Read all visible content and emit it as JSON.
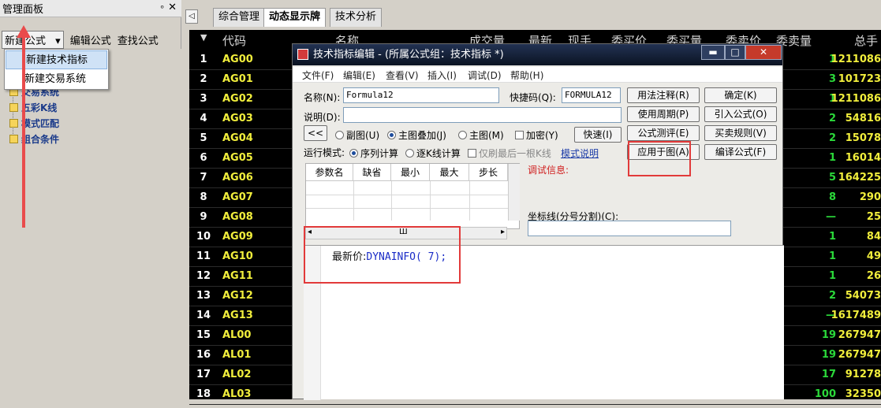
{
  "left_panel": {
    "title": "管理面板",
    "pin": "ᵒ",
    "close": "✕",
    "toolbar": {
      "new": "新建公式",
      "edit": "编辑公式",
      "find": "查找公式"
    },
    "dropdown": [
      "新建技术指标",
      "新建交易系统"
    ],
    "tree": [
      "交易系统",
      "五彩K线",
      "模式匹配",
      "组合条件"
    ]
  },
  "tabs": {
    "nav": "◁",
    "items": [
      "综合管理",
      "动态显示牌",
      "技术分析"
    ]
  },
  "grid": {
    "headers": [
      "代码",
      "名称",
      "成交量",
      "最新",
      "现手",
      "委买价",
      "委买量",
      "委卖价",
      "委卖量",
      "总手"
    ],
    "rows": [
      {
        "n": "1",
        "code": "AG00",
        "v1": "1",
        "v2": "1211086"
      },
      {
        "n": "2",
        "code": "AG01",
        "v1": "3",
        "v2": "101723"
      },
      {
        "n": "3",
        "code": "AG02",
        "v1": "1",
        "v2": "1211086"
      },
      {
        "n": "4",
        "code": "AG03",
        "v1": "2",
        "v2": "54816"
      },
      {
        "n": "5",
        "code": "AG04",
        "v1": "2",
        "v2": "15078"
      },
      {
        "n": "6",
        "code": "AG05",
        "v1": "1",
        "v2": "16014"
      },
      {
        "n": "7",
        "code": "AG06",
        "v1": "5",
        "v2": "164225"
      },
      {
        "n": "8",
        "code": "AG07",
        "v1": "8",
        "v2": "290"
      },
      {
        "n": "9",
        "code": "AG08",
        "v1": "—",
        "v2": "25"
      },
      {
        "n": "10",
        "code": "AG09",
        "v1": "1",
        "v2": "84"
      },
      {
        "n": "11",
        "code": "AG10",
        "v1": "1",
        "v2": "49"
      },
      {
        "n": "12",
        "code": "AG11",
        "v1": "1",
        "v2": "26"
      },
      {
        "n": "13",
        "code": "AG12",
        "v1": "2",
        "v2": "54073"
      },
      {
        "n": "14",
        "code": "AG13",
        "v1": "—",
        "v2": "1617489"
      },
      {
        "n": "15",
        "code": "AL00",
        "v1": "19",
        "v2": "267947"
      },
      {
        "n": "16",
        "code": "AL01",
        "v1": "19",
        "v2": "267947"
      },
      {
        "n": "17",
        "code": "AL02",
        "v1": "17",
        "v2": "91278"
      },
      {
        "n": "18",
        "code": "AL03",
        "v1": "100",
        "v2": "32350"
      }
    ]
  },
  "dialog": {
    "title": "技术指标编辑 - (所属公式组：技术指标 *)",
    "win": {
      "min": "▬",
      "max": "□",
      "close": "✕"
    },
    "menu": [
      "文件(F)",
      "编辑(E)",
      "查看(V)",
      "插入(I)",
      "调试(D)",
      "帮助(H)"
    ],
    "name_label": "名称(N):",
    "name_value": "Formula12",
    "shortcut_label": "快捷码(Q):",
    "shortcut_value": "FORMULA12",
    "desc_label": "说明(D):",
    "collapse_btn": "<<",
    "radio_sub": "副图(U)",
    "radio_main_overlay": "主图叠加(J)",
    "radio_main": "主图(M)",
    "encrypt": "加密(Y)",
    "speed_btn": "快速(I)",
    "run_mode_label": "运行模式:",
    "run_seq": "序列计算",
    "run_step": "逐K线计算",
    "refresh_last": "仅刷最后一根K线",
    "mode_link": "模式说明",
    "buttons": {
      "usage": "用法注释(R)",
      "ok": "确定(K)",
      "period": "使用周期(P)",
      "import": "引入公式(O)",
      "test": "公式测评(E)",
      "trade_rule": "买卖规则(V)",
      "apply": "应用于图(A)",
      "compile": "编译公式(F)"
    },
    "param_headers": [
      "参数名",
      "缺省",
      "最小",
      "最大",
      "步长"
    ],
    "hscroll": "Ш",
    "debug_label": "调试信息:",
    "axis_label": "坐标线(分号分割)(C):",
    "code_text": "最新价:",
    "code_func": "DYNAINFO(",
    "code_num": "  7);"
  }
}
